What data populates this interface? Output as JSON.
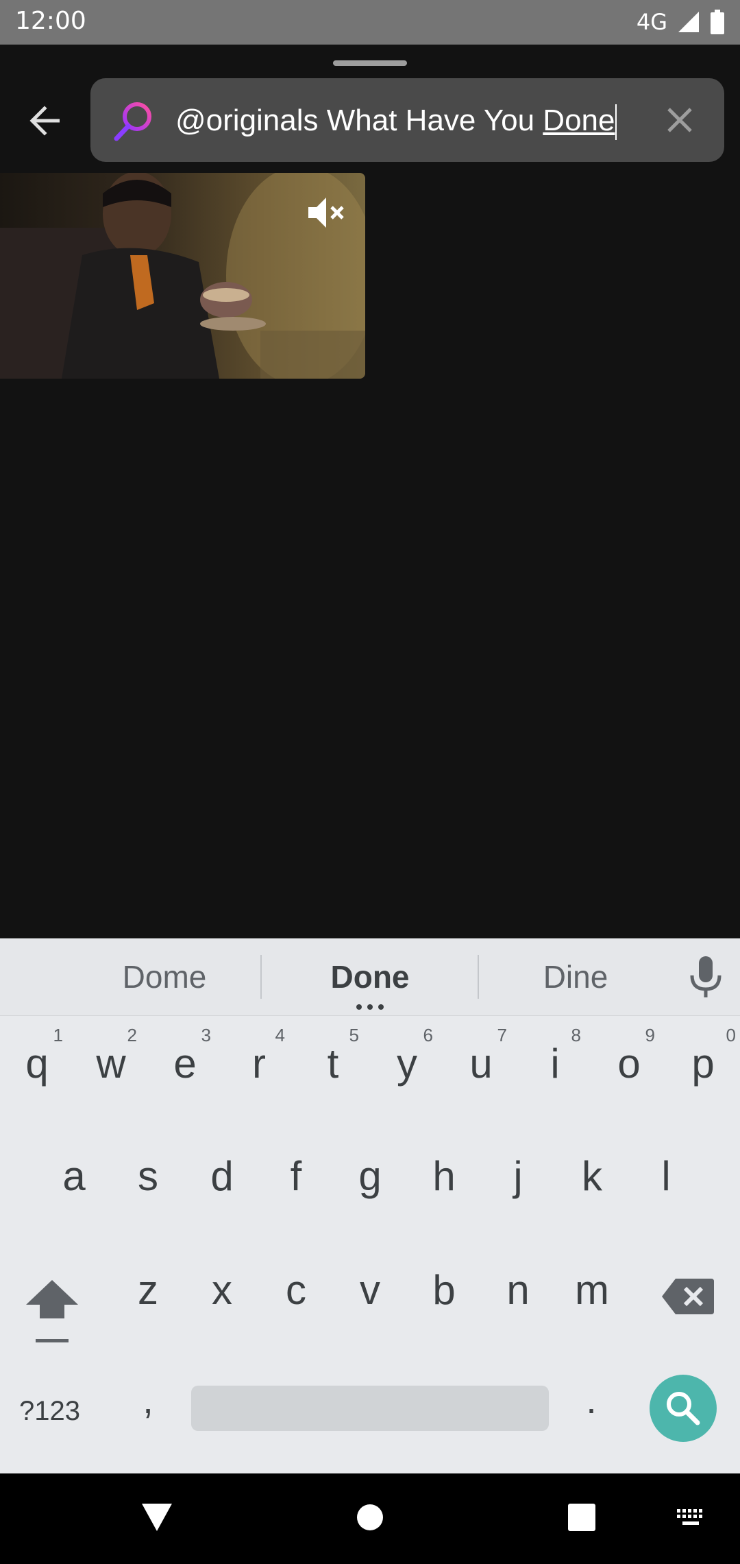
{
  "status_bar": {
    "time": "12:00",
    "network": "4G",
    "icons": [
      "signal-icon",
      "battery-icon"
    ]
  },
  "search": {
    "query_plain": "@originals What Have You ",
    "query_composing": "Done",
    "icon": "search-icon",
    "clear_icon": "close-icon"
  },
  "results": {
    "items": [
      {
        "type": "video",
        "muted": true,
        "mute_icon": "volume-off-icon"
      }
    ]
  },
  "keyboard": {
    "suggestions": [
      "Dome",
      "Done",
      "Dine"
    ],
    "row1": [
      {
        "letter": "q",
        "num": "1"
      },
      {
        "letter": "w",
        "num": "2"
      },
      {
        "letter": "e",
        "num": "3"
      },
      {
        "letter": "r",
        "num": "4"
      },
      {
        "letter": "t",
        "num": "5"
      },
      {
        "letter": "y",
        "num": "6"
      },
      {
        "letter": "u",
        "num": "7"
      },
      {
        "letter": "i",
        "num": "8"
      },
      {
        "letter": "o",
        "num": "9"
      },
      {
        "letter": "p",
        "num": "0"
      }
    ],
    "row2": [
      "a",
      "s",
      "d",
      "f",
      "g",
      "h",
      "j",
      "k",
      "l"
    ],
    "row3": [
      "z",
      "x",
      "c",
      "v",
      "b",
      "n",
      "m"
    ],
    "symbols_label": "?123",
    "comma": ",",
    "period": ".",
    "action": "search-icon",
    "accent_color": "#4db6ac"
  },
  "nav_bar": {
    "icons": [
      "back-triangle-icon",
      "home-circle-icon",
      "recents-square-icon",
      "keyboard-icon"
    ]
  }
}
